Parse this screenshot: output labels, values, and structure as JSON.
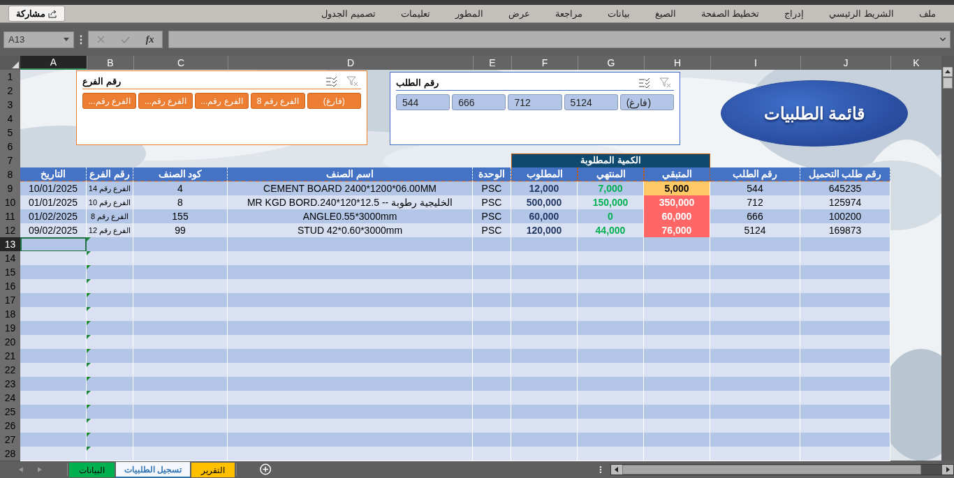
{
  "share_button": {
    "label": "مشاركة"
  },
  "ribbon_tabs": [
    "ملف",
    "الشريط الرئيسي",
    "إدراج",
    "تخطيط الصفحة",
    "الصيغ",
    "بيانات",
    "مراجعة",
    "عرض",
    "المطور",
    "تعليمات",
    "تصميم الجدول"
  ],
  "formula_bar": {
    "name_box": "A13",
    "fx_label": "fx"
  },
  "column_headers": [
    {
      "label": "K",
      "selected": false
    },
    {
      "label": "J",
      "selected": false
    },
    {
      "label": "I",
      "selected": false
    },
    {
      "label": "H",
      "selected": false
    },
    {
      "label": "G",
      "selected": false
    },
    {
      "label": "F",
      "selected": false
    },
    {
      "label": "E",
      "selected": false
    },
    {
      "label": "D",
      "selected": false
    },
    {
      "label": "C",
      "selected": false
    },
    {
      "label": "B",
      "selected": false
    },
    {
      "label": "A",
      "selected": true
    }
  ],
  "row_headers": [
    {
      "label": "1",
      "selected": false
    },
    {
      "label": "2",
      "selected": false
    },
    {
      "label": "3",
      "selected": false
    },
    {
      "label": "4",
      "selected": false
    },
    {
      "label": "5",
      "selected": false
    },
    {
      "label": "6",
      "selected": false
    },
    {
      "label": "7",
      "selected": false
    },
    {
      "label": "8",
      "selected": false
    },
    {
      "label": "9",
      "selected": false
    },
    {
      "label": "10",
      "selected": false
    },
    {
      "label": "11",
      "selected": false
    },
    {
      "label": "12",
      "selected": false
    },
    {
      "label": "13",
      "selected": true
    },
    {
      "label": "14",
      "selected": false
    },
    {
      "label": "15",
      "selected": false
    },
    {
      "label": "16",
      "selected": false
    },
    {
      "label": "17",
      "selected": false
    },
    {
      "label": "18",
      "selected": false
    },
    {
      "label": "19",
      "selected": false
    },
    {
      "label": "20",
      "selected": false
    },
    {
      "label": "21",
      "selected": false
    },
    {
      "label": "22",
      "selected": false
    },
    {
      "label": "23",
      "selected": false
    },
    {
      "label": "24",
      "selected": false
    },
    {
      "label": "25",
      "selected": false
    },
    {
      "label": "26",
      "selected": false
    },
    {
      "label": "27",
      "selected": false
    },
    {
      "label": "28",
      "selected": false
    }
  ],
  "slicers": [
    {
      "kind": "blue",
      "title": "رقم الطلب",
      "items": [
        {
          "label": "(فارغ)",
          "selected": true
        },
        {
          "label": "5124",
          "selected": true
        },
        {
          "label": "712",
          "selected": true
        },
        {
          "label": "666",
          "selected": true
        },
        {
          "label": "544",
          "selected": true
        }
      ]
    },
    {
      "kind": "orange",
      "title": "رقم الفرع",
      "items": [
        {
          "label": "(فارغ)",
          "selected": true
        },
        {
          "label": "الفرع رقم 8",
          "selected": true
        },
        {
          "label": "الفرع رقم...",
          "selected": true
        },
        {
          "label": "الفرع رقم...",
          "selected": true
        },
        {
          "label": "الفرع رقم...",
          "selected": true
        }
      ]
    }
  ],
  "title_shape": {
    "text": "قائمة الطلبيات"
  },
  "table": {
    "group_header": "الكمية المطلوبة",
    "columns": [
      "رقم طلب التحميل",
      "رقم الطلب",
      "المتبقي",
      "المنتهي",
      "المطلوب",
      "الوحدة",
      "اسم الصنف",
      "كود الصنف",
      "رقم الفرع",
      "التاريخ"
    ],
    "rows": [
      {
        "cells": [
          "645235",
          "544",
          "5,000",
          "7,000",
          "12,000",
          "PSC",
          "CEMENT BOARD 2400*1200*06.00MM",
          "4",
          "الفرع رقم 14",
          "10/01/2025"
        ],
        "color": "#ffc966"
      },
      {
        "cells": [
          "125974",
          "712",
          "350,000",
          "150,000",
          "500,000",
          "PSC",
          "الخليجية رطوبة -- MR KGD BORD.240*120*12.5",
          "8",
          "الفرع رقم 10",
          "01/01/2025"
        ],
        "color": "#ff6666"
      },
      {
        "cells": [
          "100200",
          "666",
          "60,000",
          "0",
          "60,000",
          "PSC",
          "ANGLE0.55*3000mm",
          "155",
          "الفرع رقم 8",
          "01/02/2025"
        ],
        "color": "#ff6666"
      },
      {
        "cells": [
          "169873",
          "5124",
          "76,000",
          "44,000",
          "120,000",
          "PSC",
          "STUD 42*0.60*3000mm",
          "99",
          "الفرع رقم 12",
          "09/02/2025"
        ],
        "color": "#ff6666"
      }
    ],
    "blank_rows": [
      {
        "selected": true,
        "error_indicator": true
      },
      {
        "selected": false,
        "error_indicator": true
      },
      {
        "selected": false,
        "error_indicator": true
      },
      {
        "selected": false,
        "error_indicator": true
      },
      {
        "selected": false,
        "error_indicator": true
      },
      {
        "selected": false,
        "error_indicator": true
      },
      {
        "selected": false,
        "error_indicator": true
      },
      {
        "selected": false,
        "error_indicator": true
      },
      {
        "selected": false,
        "error_indicator": true
      },
      {
        "selected": false,
        "error_indicator": true
      },
      {
        "selected": false,
        "error_indicator": true
      },
      {
        "selected": false,
        "error_indicator": true
      },
      {
        "selected": false,
        "error_indicator": true
      },
      {
        "selected": false,
        "error_indicator": true
      },
      {
        "selected": false,
        "error_indicator": true
      },
      {
        "selected": false,
        "error_indicator": true
      }
    ]
  },
  "sheet_tabs": [
    {
      "label": "التقرير",
      "color": "#ffc000",
      "selected": false
    },
    {
      "label": "تسجيل الطلبيات",
      "color": "#2e75b6",
      "selected": true
    },
    {
      "label": "البيانات",
      "color": "#00b050",
      "selected": false
    }
  ]
}
